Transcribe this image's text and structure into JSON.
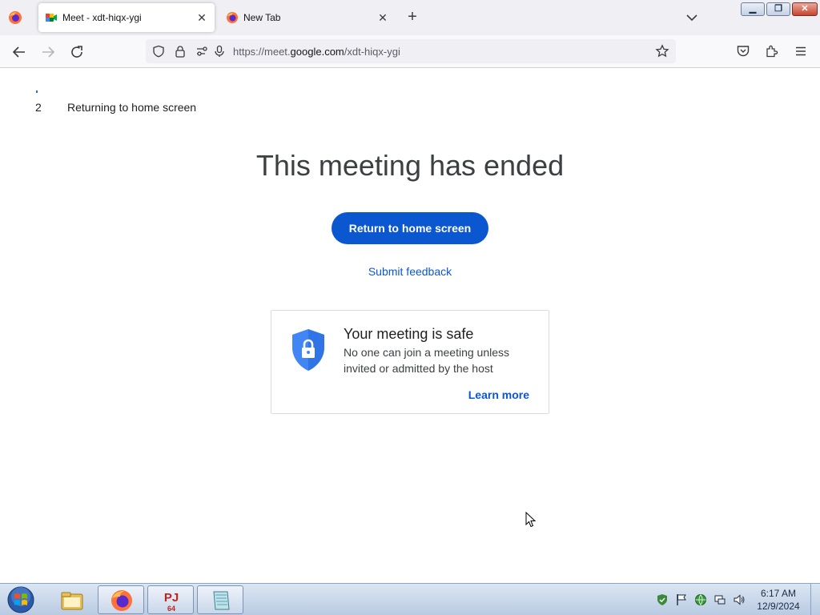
{
  "browser": {
    "tabs": [
      {
        "title": "Meet - xdt-hiqx-ygi",
        "active": true,
        "favicon": "google-meet-icon"
      },
      {
        "title": "New Tab",
        "active": false,
        "favicon": "firefox-icon"
      }
    ],
    "url_prefix": "https://meet.",
    "url_host": "google.com",
    "url_path": "/xdt-hiqx-ygi"
  },
  "page": {
    "countdown": "2",
    "countdown_label": "Returning to home screen",
    "headline": "This meeting has ended",
    "primary_button": "Return to home screen",
    "feedback_link": "Submit feedback",
    "safe_card": {
      "title": "Your meeting is safe",
      "body": "No one can join a meeting unless invited or admitted by the host",
      "link": "Learn more"
    }
  },
  "taskbar": {
    "time": "6:17 AM",
    "date": "12/9/2024"
  },
  "colors": {
    "primary_blue": "#0b57d0",
    "shield_blue": "#4285f4"
  }
}
